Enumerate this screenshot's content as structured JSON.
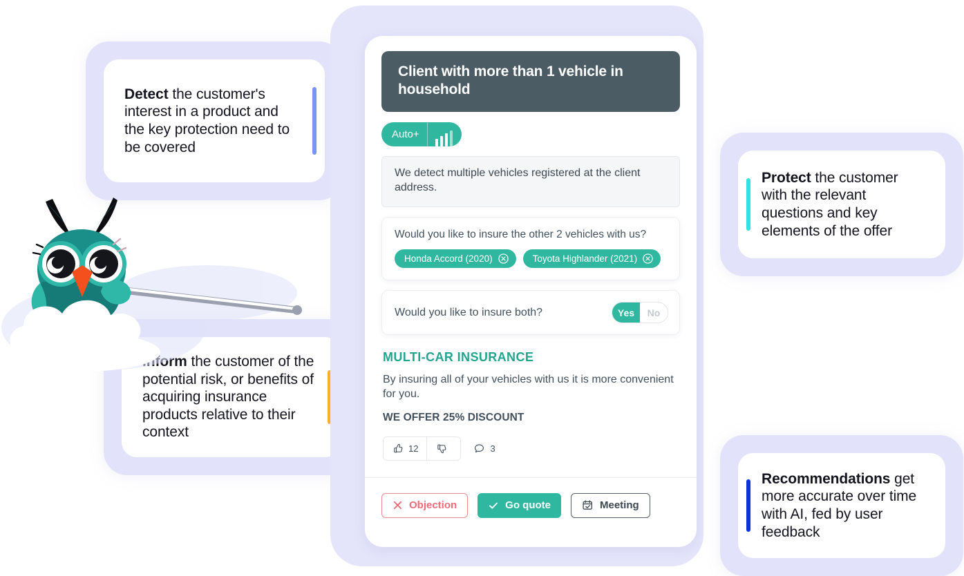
{
  "annotations": [
    {
      "key": "detect",
      "lead": "Detect",
      "rest": " the customer's interest in a product and the key protection need to be covered",
      "accent_color": "#7b93f5",
      "accent_side": "right",
      "accent_height": 98
    },
    {
      "key": "inform",
      "lead": "Inform",
      "rest": " the customer of the potential risk, or benefits of acquiring insurance products relative to their context",
      "accent_color": "#ffb020",
      "accent_side": "right",
      "accent_height": 78
    },
    {
      "key": "protect",
      "lead": "Protect",
      "rest": " the customer with the relevant questions and key elements of the offer",
      "accent_color": "#2ee6df",
      "accent_side": "left",
      "accent_height": 76
    },
    {
      "key": "recommendations",
      "lead": "Recommendations",
      "rest": " get more accurate over time with AI, fed by user feedback",
      "accent_color": "#1330dd",
      "accent_side": "left",
      "accent_height": 76
    }
  ],
  "mascot": {
    "name": "owl-mascot-on-cloud",
    "body_color": "#1a8f8a",
    "accent_color": "#2fb7a8",
    "beak_color": "#f4501e",
    "cloud_color": "#ffffff",
    "pointer_color": "#ffffff"
  },
  "panel": {
    "header": {
      "title": "Client with more than 1 vehicle in household",
      "background": "#4b5c65"
    },
    "badge": {
      "label": "Auto+",
      "icon": "signal-bars-icon",
      "color": "#2fb79f",
      "bars": [
        11,
        15,
        19,
        23
      ]
    },
    "detection_note": "We detect multiple vehicles registered at the client address.",
    "vehicle_question": {
      "text": "Would you like to insure the other 2 vehicles with us?",
      "chips": [
        {
          "label": "Honda Accord (2020)",
          "remove_icon": "close-circle-icon"
        },
        {
          "label": "Toyota Highlander (2021)",
          "remove_icon": "close-circle-icon"
        }
      ]
    },
    "both_question": {
      "label": "Would you like to insure both?",
      "options": [
        "Yes",
        "No"
      ],
      "selected": "Yes"
    },
    "offer": {
      "title": "MULTI-CAR INSURANCE",
      "body": "By insuring all of your vehicles with us it is more convenient for you.",
      "discount": "WE OFFER 25% DISCOUNT",
      "accent_color": "#22a58f"
    },
    "reactions": {
      "like": {
        "icon": "thumbs-up-icon",
        "count": "12"
      },
      "dislike": {
        "icon": "thumbs-down-icon",
        "count": ""
      },
      "comment": {
        "icon": "comment-bubble-icon",
        "count": "3"
      }
    },
    "actions": [
      {
        "key": "objection",
        "label": "Objection",
        "icon": "close-x-icon",
        "style": "outline-red"
      },
      {
        "key": "go-quote",
        "label": "Go quote",
        "icon": "check-icon",
        "style": "filled-teal"
      },
      {
        "key": "meeting",
        "label": "Meeting",
        "icon": "calendar-check-icon",
        "style": "outline-dark"
      }
    ]
  }
}
